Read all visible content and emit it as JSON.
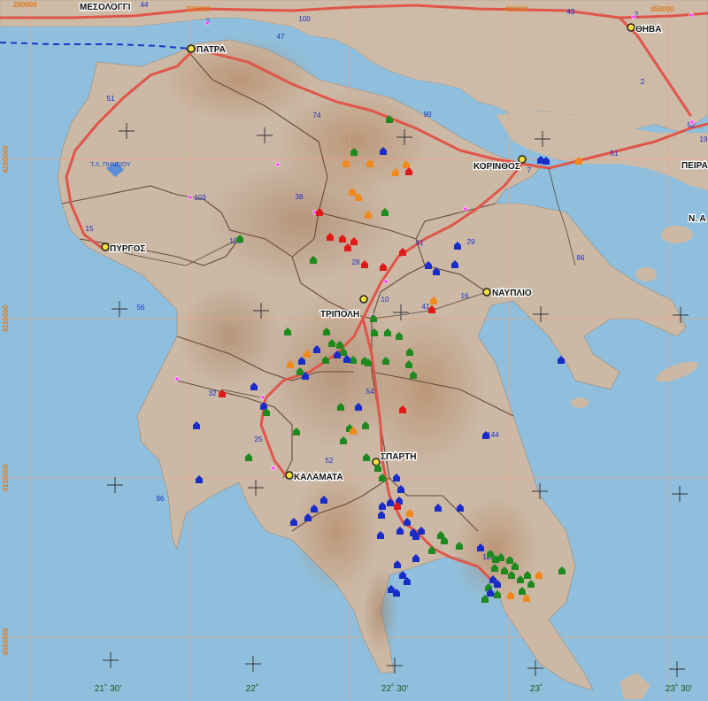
{
  "map": {
    "cities": [
      {
        "name": "ΜΕΣΟΛΟΓΓΙ"
      },
      {
        "name": "ΠΑΤΡΑ"
      },
      {
        "name": "ΘΗΒΑ"
      },
      {
        "name": "ΚΟΡΙΝΘΟΣ"
      },
      {
        "name": "ΠΕΙΡΑ"
      },
      {
        "name": "Ν. Α"
      },
      {
        "name": "ΠΥΡΓΟΣ"
      },
      {
        "name": "ΝΑΥΠΛΙΟ"
      },
      {
        "name": "ΤΡΙΠΟΛΗ"
      },
      {
        "name": "ΣΠΑΡΤΗ"
      },
      {
        "name": "ΚΑΛΑΜΑΤΑ"
      }
    ],
    "lake_label": "Τ.Λ. ΠΗΝΕΙΟΥ",
    "road_numbers": [
      "44",
      "100",
      "6",
      "47",
      "43",
      "2",
      "51",
      "52",
      "74",
      "90",
      "2",
      "19",
      "51",
      "7",
      "38",
      "103",
      "15",
      "108",
      "41",
      "29",
      "28",
      "86",
      "10",
      "16",
      "56",
      "41",
      "32",
      "54",
      "25",
      "144",
      "52",
      "96",
      "120"
    ],
    "grid_labels_top": [
      "250000",
      "300000",
      "400000",
      "450000"
    ],
    "grid_labels_left": [
      "4250000",
      "4150000",
      "4100000",
      "4050000"
    ],
    "lon_labels": [
      "21˚ 30'",
      "22˚",
      "22˚ 30'",
      "23˚",
      "23˚ 30'"
    ],
    "colors": {
      "sea": "#8fbfdc",
      "land": "#cbb9a6",
      "road": "#e0554a",
      "border": "#6a4a3a",
      "marker_blue": "#1a2cc8",
      "marker_green": "#1e8a1e",
      "marker_orange": "#f08a1c",
      "marker_red": "#e01818",
      "city_dot": "#f5e03a"
    }
  }
}
